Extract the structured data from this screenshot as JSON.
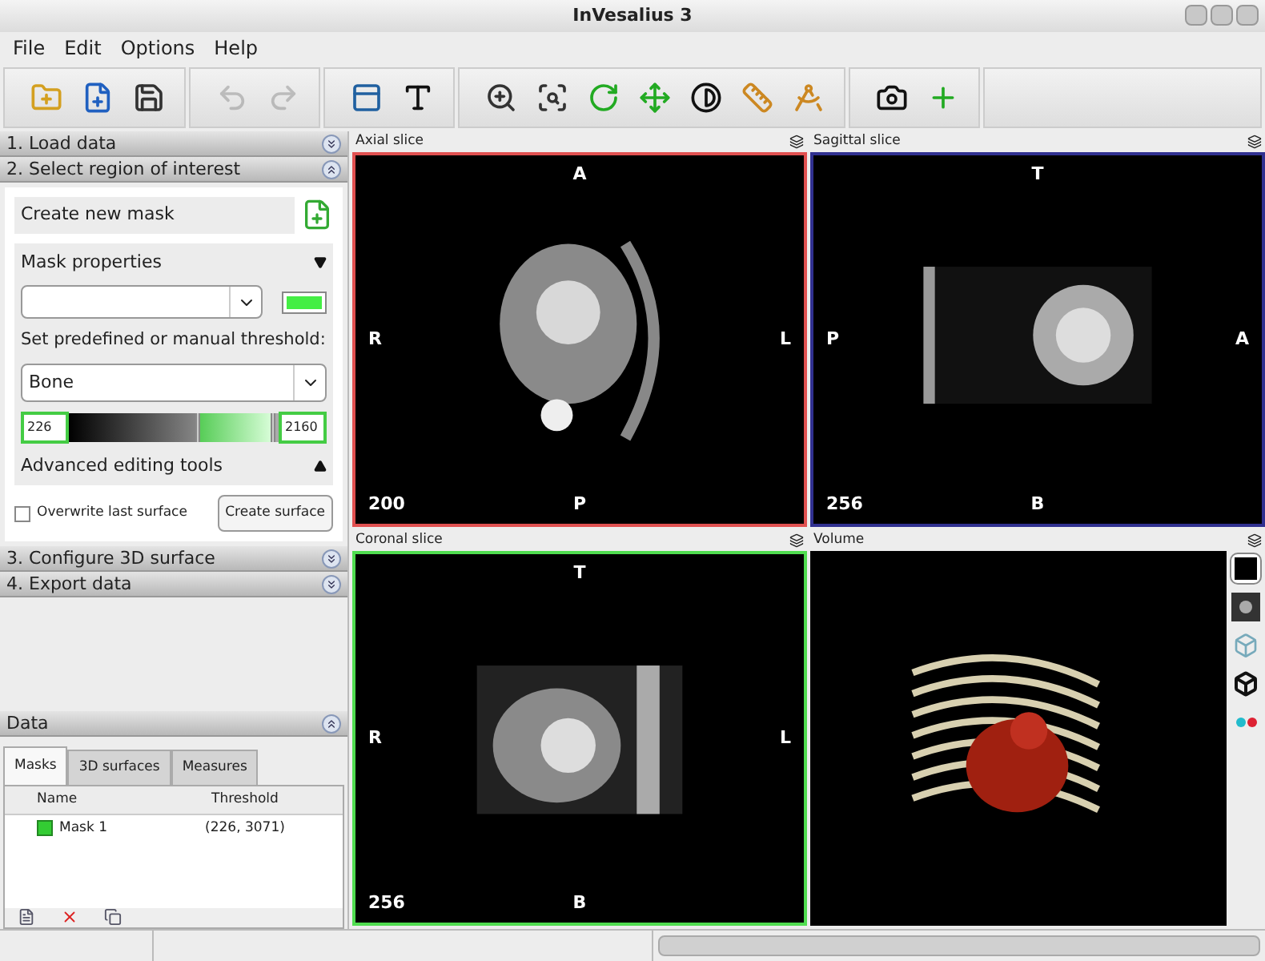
{
  "window": {
    "title": "InVesalius 3"
  },
  "menu": [
    "File",
    "Edit",
    "Options",
    "Help"
  ],
  "toolbar": [
    [
      {
        "kind": "open",
        "disabled": false
      },
      {
        "kind": "import",
        "disabled": false
      },
      {
        "kind": "save",
        "disabled": false
      }
    ],
    [
      {
        "kind": "undo",
        "disabled": true
      },
      {
        "kind": "redo",
        "disabled": true
      }
    ],
    [
      {
        "kind": "layout",
        "disabled": false
      },
      {
        "kind": "text",
        "disabled": false
      }
    ],
    [
      {
        "kind": "zoom",
        "disabled": false
      },
      {
        "kind": "zoom-select",
        "disabled": false
      },
      {
        "kind": "rotate",
        "disabled": false
      },
      {
        "kind": "move",
        "disabled": false
      },
      {
        "kind": "contrast",
        "disabled": false
      },
      {
        "kind": "ruler",
        "disabled": false
      },
      {
        "kind": "angle",
        "disabled": false
      }
    ],
    [
      {
        "kind": "snapshot",
        "disabled": false
      },
      {
        "kind": "add",
        "disabled": false
      }
    ]
  ],
  "sections": [
    {
      "label": "1. Load data",
      "expanded": false
    },
    {
      "label": "2. Select region of interest",
      "expanded": true
    },
    {
      "label": "3. Configure 3D surface",
      "expanded": false
    },
    {
      "label": "4. Export data",
      "expanded": false
    }
  ],
  "roi": {
    "create_mask": "Create new mask",
    "mask_properties": {
      "label": "Mask properties",
      "expanded": true
    },
    "threshold_label": "Set predefined or manual threshold:",
    "preset": "Bone",
    "min": "226",
    "max": "2160",
    "thumbs": [
      {
        "level": 0.62
      },
      {
        "level": 0.98
      }
    ],
    "advanced": {
      "label": "Advanced editing tools",
      "expanded": false
    },
    "overwrite": {
      "label": "Overwrite last surface",
      "checked": false
    },
    "create_surface": "Create surface"
  },
  "data": {
    "title": "Data",
    "expanded": true,
    "tabs": [
      {
        "label": "Masks",
        "selected": true
      },
      {
        "label": "3D surfaces",
        "selected": false
      },
      {
        "label": "Measures",
        "selected": false
      }
    ],
    "columns": [
      "Name",
      "Threshold"
    ],
    "rows": [
      {
        "name": "Mask 1",
        "threshold": "(226, 3071)",
        "color": "#33cc33"
      }
    ]
  },
  "viewports": [
    {
      "title": "Axial slice",
      "kind": "slice",
      "color": "#e05050",
      "top": "A",
      "left": "R",
      "right": "L",
      "bottom": "P",
      "number": "200"
    },
    {
      "title": "Sagittal slice",
      "kind": "slice",
      "color": "#303090",
      "top": "T",
      "left": "P",
      "right": "A",
      "bottom": "B",
      "number": "256"
    },
    {
      "title": "Coronal slice",
      "kind": "slice",
      "color": "#50dd50",
      "top": "T",
      "left": "R",
      "right": "L",
      "bottom": "B",
      "number": "256"
    },
    {
      "title": "Volume",
      "kind": "volume"
    }
  ],
  "progress": {
    "level": 0
  },
  "volume_tools": [
    {
      "kind": "background",
      "selected": true
    },
    {
      "kind": "preset",
      "selected": false
    },
    {
      "kind": "cube",
      "selected": false
    },
    {
      "kind": "views",
      "selected": false
    },
    {
      "kind": "stereo",
      "selected": false
    }
  ]
}
